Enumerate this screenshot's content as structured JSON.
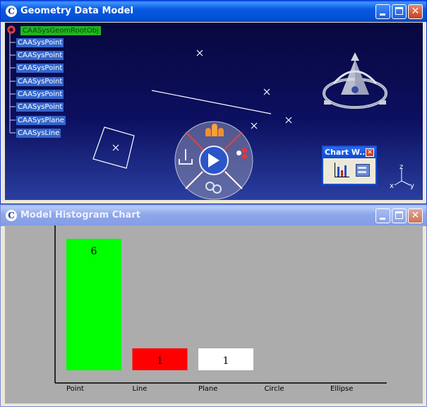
{
  "top_window": {
    "title": "Geometry Data Model",
    "tree": {
      "root": "CAASysGeomRootObj",
      "items": [
        "CAASysPoint",
        "CAASysPoint",
        "CAASysPoint",
        "CAASysPoint",
        "CAASysPoint",
        "CAASysPoint",
        "CAASysPlane",
        "CAASysLine"
      ]
    },
    "chart_window": {
      "title": "Chart W..."
    },
    "axis_labels": {
      "x": "x",
      "y": "y",
      "z": "z"
    }
  },
  "bottom_window": {
    "title": "Model Histogram Chart"
  },
  "chart_data": {
    "type": "bar",
    "categories": [
      "Point",
      "Line",
      "Plane",
      "Circle",
      "Ellipse"
    ],
    "values": [
      6,
      1,
      1,
      0,
      0
    ],
    "data_labels": [
      "6",
      "1",
      "1",
      "",
      ""
    ],
    "colors": [
      "#00ff00",
      "#ff0000",
      "#ffffff",
      "",
      ""
    ],
    "ylim": [
      0,
      6
    ],
    "grid": false
  },
  "colors": {
    "titlebar_active": "#0a5fe6",
    "titlebar_inactive": "#8ea6ea",
    "viewer_bg": "#0c1060",
    "chart_bg": "#acacac"
  }
}
